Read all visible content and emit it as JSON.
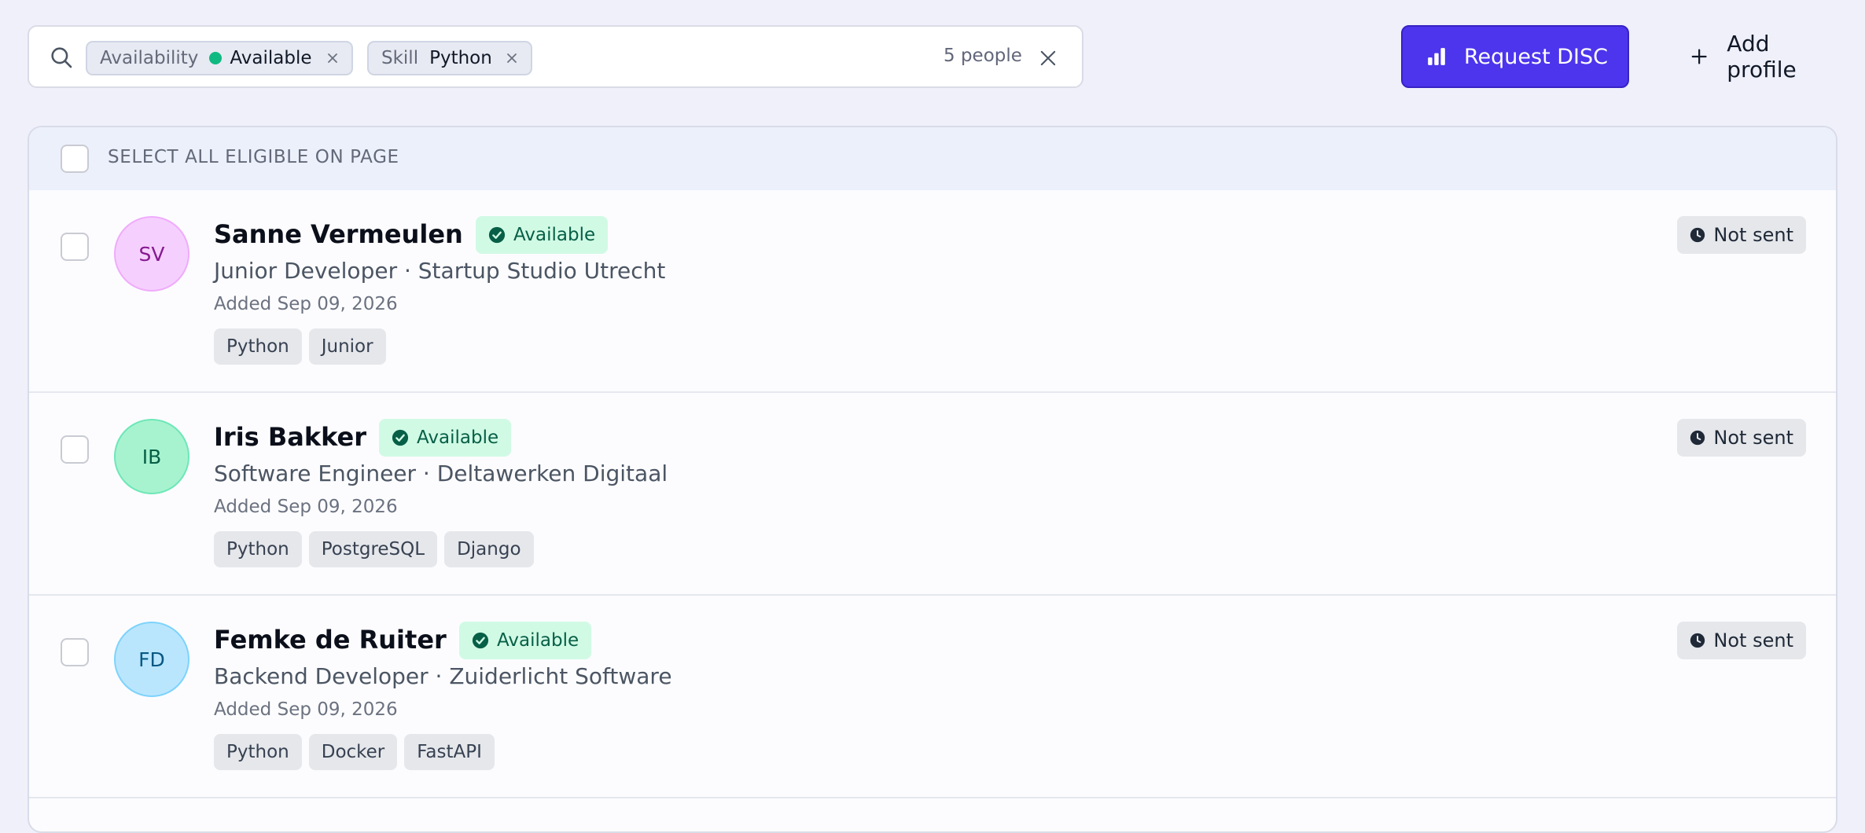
{
  "search": {
    "filters": [
      {
        "key": "Availability",
        "value": "Available"
      },
      {
        "key": "Skill",
        "value": "Python"
      }
    ],
    "count_label": "5 people"
  },
  "actions": {
    "request_disc_label": "Request DISC",
    "add_profile_label": "Add profile"
  },
  "list": {
    "select_all_label": "SELECT ALL ELIGIBLE ON PAGE",
    "people": [
      {
        "initials": "SV",
        "name": "Sanne Vermeulen",
        "status": "Available",
        "subtitle": "Junior Developer · Startup Studio Utrecht",
        "added": "Added Sep 09, 2026",
        "tags": [
          "Python",
          "Junior"
        ],
        "disc_status": "Not sent",
        "avatar_bg": "#f5d0fe",
        "avatar_border": "#f0abfc",
        "avatar_fg": "#86198f"
      },
      {
        "initials": "IB",
        "name": "Iris Bakker",
        "status": "Available",
        "subtitle": "Software Engineer · Deltawerken Digitaal",
        "added": "Added Sep 09, 2026",
        "tags": [
          "Python",
          "PostgreSQL",
          "Django"
        ],
        "disc_status": "Not sent",
        "avatar_bg": "#a7f3d0",
        "avatar_border": "#6ee7b7",
        "avatar_fg": "#065f46"
      },
      {
        "initials": "FD",
        "name": "Femke de Ruiter",
        "status": "Available",
        "subtitle": "Backend Developer · Zuiderlicht Software",
        "added": "Added Sep 09, 2026",
        "tags": [
          "Python",
          "Docker",
          "FastAPI"
        ],
        "disc_status": "Not sent",
        "avatar_bg": "#bae6fd",
        "avatar_border": "#7dd3fc",
        "avatar_fg": "#075985"
      }
    ]
  },
  "colors": {
    "accent": "#4c35ec",
    "available_dot": "#10b981",
    "status_bg": "#d1fae5",
    "status_fg": "#065f46"
  }
}
